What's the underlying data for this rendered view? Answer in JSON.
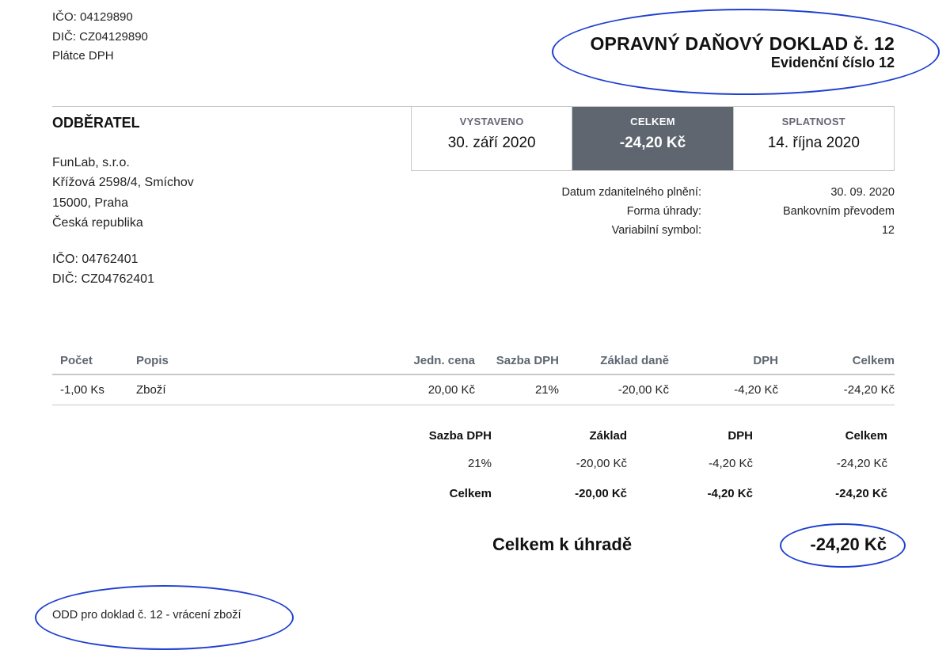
{
  "seller": {
    "ico": "IČO: 04129890",
    "dic": "DIČ: CZ04129890",
    "vat_status": "Plátce DPH"
  },
  "document": {
    "title": "OPRAVNÝ DAŇOVÝ DOKLAD č. 12",
    "subtitle": "Evidenční číslo 12"
  },
  "buyer": {
    "heading": "ODBĚRATEL",
    "name": "FunLab, s.r.o.",
    "street": "Křížová 2598/4, Smíchov",
    "city": "15000, Praha",
    "country": "Česká republika",
    "ico": "IČO: 04762401",
    "dic": "DIČ: CZ04762401"
  },
  "summary_boxes": {
    "issued_label": "VYSTAVENO",
    "issued_value": "30. září 2020",
    "total_label": "CELKEM",
    "total_value": "-24,20 Kč",
    "due_label": "SPLATNOST",
    "due_value": "14. října 2020"
  },
  "meta": [
    {
      "label": "Datum zdanitelného plnění:",
      "value": "30. 09. 2020"
    },
    {
      "label": "Forma úhrady:",
      "value": "Bankovním převodem"
    },
    {
      "label": "Variabilní symbol:",
      "value": "12"
    }
  ],
  "items_table": {
    "headers": [
      "Počet",
      "Popis",
      "Jedn. cena",
      "Sazba DPH",
      "Základ daně",
      "DPH",
      "Celkem"
    ],
    "rows": [
      [
        "-1,00 Ks",
        "Zboží",
        "20,00 Kč",
        "21%",
        "-20,00 Kč",
        "-4,20 Kč",
        "-24,20 Kč"
      ]
    ]
  },
  "vat_table": {
    "headers": [
      "Sazba DPH",
      "Základ",
      "DPH",
      "Celkem"
    ],
    "rows": [
      [
        "21%",
        "-20,00 Kč",
        "-4,20 Kč",
        "-24,20 Kč"
      ]
    ],
    "sum_row": [
      "Celkem",
      "-20,00 Kč",
      "-4,20 Kč",
      "-24,20 Kč"
    ]
  },
  "total_due": {
    "label": "Celkem k úhradě",
    "value": "-24,20 Kč"
  },
  "note": "ODD pro doklad č. 12 - vrácení zboží",
  "colors": {
    "annotation_ellipse": "#1f3fd1",
    "total_box_bg": "#5f6670",
    "rule": "#c8c8c8"
  }
}
